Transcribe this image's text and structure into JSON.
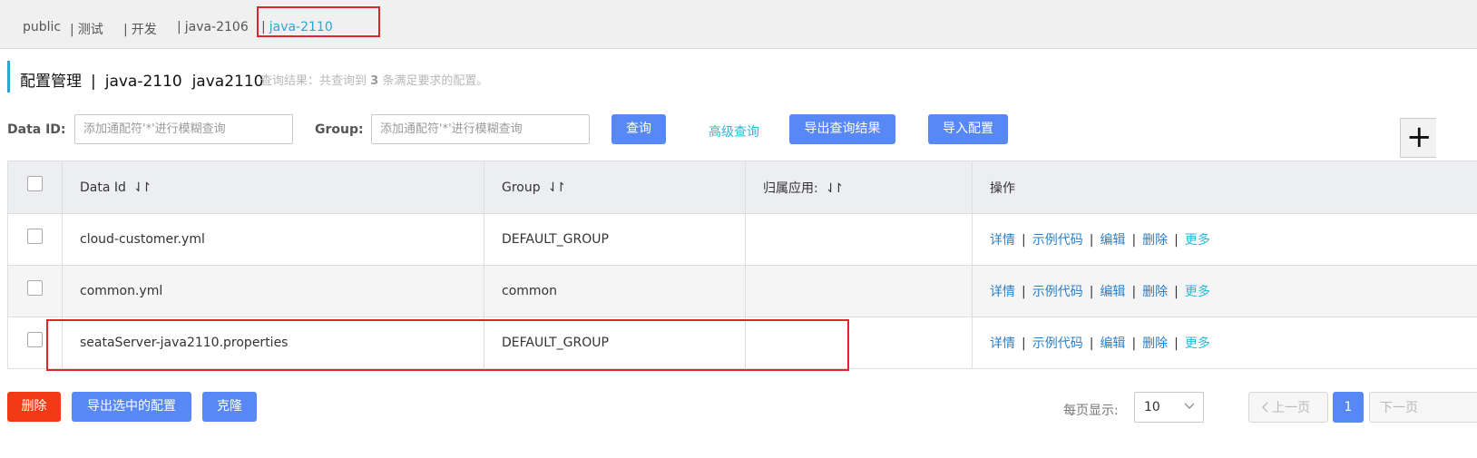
{
  "namespaces": {
    "items": [
      "public",
      "测试",
      "开发",
      "java-2106",
      "java-2110"
    ],
    "separator": "|",
    "active": "java-2110"
  },
  "header": {
    "title": "配置管理",
    "separator": "|",
    "namespace_name": "java-2110",
    "namespace_id": "java2110",
    "result_prefix": "查询结果：共查询到",
    "result_count": "3",
    "result_suffix": "条满足要求的配置。"
  },
  "search": {
    "data_id_label": "Data ID:",
    "data_id_placeholder": "添加通配符'*'进行模糊查询",
    "group_label": "Group:",
    "group_placeholder": "添加通配符'*'进行模糊查询",
    "query_button": "查询",
    "advanced_query": "高级查询",
    "export_results_button": "导出查询结果",
    "import_button": "导入配置",
    "add_button": "+"
  },
  "table": {
    "columns": [
      "Data Id",
      "Group",
      "归属应用:",
      "操作"
    ],
    "sort_icon": "⇃↾",
    "rows": [
      {
        "data_id": "cloud-customer.yml",
        "group": "DEFAULT_GROUP",
        "app": ""
      },
      {
        "data_id": "common.yml",
        "group": "common",
        "app": ""
      },
      {
        "data_id": "seataServer-java2110.properties",
        "group": "DEFAULT_GROUP",
        "app": ""
      }
    ],
    "actions": {
      "detail": "详情",
      "sample_code": "示例代码",
      "edit": "编辑",
      "delete": "删除",
      "more": "更多",
      "separator": "|"
    }
  },
  "footer": {
    "delete_button": "删除",
    "export_selected_button": "导出选中的配置",
    "clone_button": "克隆",
    "page_size_label": "每页显示:",
    "page_size_value": "10",
    "prev_page": "上一页",
    "current_page": "1",
    "next_page": "下一页"
  },
  "colors": {
    "primary_button": "#5788f5",
    "danger_button": "#f13b17",
    "link": "#2a7fc8",
    "accent": "#29a6d3",
    "annotation_box": "#e0242c"
  }
}
